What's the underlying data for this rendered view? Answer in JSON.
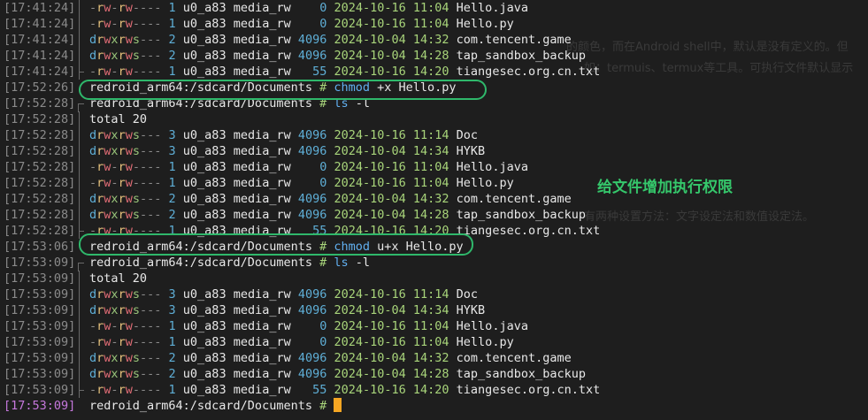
{
  "background_fragments": [
    "的颜色，而在Android shell中，默认是没有定义的。但",
    "如：termuis、termux等工具。可执行文件默认显示",
    "有两种设置方法：文字设定法和数值设定法。"
  ],
  "annotation": "给文件增加执行权限",
  "lines": [
    {
      "ts": "[17:41:24]",
      "gutter": "line",
      "type": "file",
      "perm": "-rw-rw----",
      "links": "1",
      "owner": "u0_a83",
      "group": "media_rw",
      "size": "0",
      "date": "2024-10-16",
      "time": "11:04",
      "name": "Hello.java"
    },
    {
      "ts": "[17:41:24]",
      "gutter": "line",
      "type": "file",
      "perm": "-rw-rw----",
      "links": "1",
      "owner": "u0_a83",
      "group": "media_rw",
      "size": "0",
      "date": "2024-10-16",
      "time": "11:04",
      "name": "Hello.py"
    },
    {
      "ts": "[17:41:24]",
      "gutter": "line",
      "type": "file",
      "perm": "drwxrws---",
      "links": "2",
      "owner": "u0_a83",
      "group": "media_rw",
      "size": "4096",
      "date": "2024-10-04",
      "time": "14:32",
      "name": "com.tencent.game"
    },
    {
      "ts": "[17:41:24]",
      "gutter": "line",
      "type": "file",
      "perm": "drwxrws---",
      "links": "2",
      "owner": "u0_a83",
      "group": "media_rw",
      "size": "4096",
      "date": "2024-10-04",
      "time": "14:28",
      "name": "tap_sandbox_backup"
    },
    {
      "ts": "[17:41:24]",
      "gutter": "end",
      "type": "file",
      "perm": "-rw-rw----",
      "links": "1",
      "owner": "u0_a83",
      "group": "media_rw",
      "size": "55",
      "date": "2024-10-16",
      "time": "14:20",
      "name": "tiangesec.org.cn.txt"
    },
    {
      "ts": "[17:52:26]",
      "gutter": "none",
      "type": "prompt",
      "prompt": "redroid_arm64:/sdcard/Documents",
      "hash": "#",
      "cmd": "chmod",
      "args": "+x Hello.py",
      "circled": true
    },
    {
      "ts": "[17:52:28]",
      "gutter": "start",
      "type": "prompt",
      "prompt": "redroid_arm64:/sdcard/Documents",
      "hash": "#",
      "cmd": "ls",
      "args": "-l"
    },
    {
      "ts": "[17:52:28]",
      "gutter": "line",
      "type": "text",
      "text": "total 20"
    },
    {
      "ts": "[17:52:28]",
      "gutter": "line",
      "type": "file",
      "perm": "drwxrws---",
      "links": "3",
      "owner": "u0_a83",
      "group": "media_rw",
      "size": "4096",
      "date": "2024-10-16",
      "time": "11:14",
      "name": "Doc"
    },
    {
      "ts": "[17:52:28]",
      "gutter": "line",
      "type": "file",
      "perm": "drwxrws---",
      "links": "3",
      "owner": "u0_a83",
      "group": "media_rw",
      "size": "4096",
      "date": "2024-10-04",
      "time": "14:34",
      "name": "HYKB"
    },
    {
      "ts": "[17:52:28]",
      "gutter": "line",
      "type": "file",
      "perm": "-rw-rw----",
      "links": "1",
      "owner": "u0_a83",
      "group": "media_rw",
      "size": "0",
      "date": "2024-10-16",
      "time": "11:04",
      "name": "Hello.java"
    },
    {
      "ts": "[17:52:28]",
      "gutter": "line",
      "type": "file",
      "perm": "-rw-rw----",
      "links": "1",
      "owner": "u0_a83",
      "group": "media_rw",
      "size": "0",
      "date": "2024-10-16",
      "time": "11:04",
      "name": "Hello.py"
    },
    {
      "ts": "[17:52:28]",
      "gutter": "line",
      "type": "file",
      "perm": "drwxrws---",
      "links": "2",
      "owner": "u0_a83",
      "group": "media_rw",
      "size": "4096",
      "date": "2024-10-04",
      "time": "14:32",
      "name": "com.tencent.game"
    },
    {
      "ts": "[17:52:28]",
      "gutter": "line",
      "type": "file",
      "perm": "drwxrws---",
      "links": "2",
      "owner": "u0_a83",
      "group": "media_rw",
      "size": "4096",
      "date": "2024-10-04",
      "time": "14:28",
      "name": "tap_sandbox_backup"
    },
    {
      "ts": "[17:52:28]",
      "gutter": "end",
      "type": "file",
      "perm": "-rw-rw----",
      "links": "1",
      "owner": "u0_a83",
      "group": "media_rw",
      "size": "55",
      "date": "2024-10-16",
      "time": "14:20",
      "name": "tiangesec.org.cn.txt"
    },
    {
      "ts": "[17:53:06]",
      "gutter": "none",
      "type": "prompt",
      "prompt": "redroid_arm64:/sdcard/Documents",
      "hash": "#",
      "cmd": "chmod",
      "args": "u+x Hello.py",
      "circled": true
    },
    {
      "ts": "[17:53:09]",
      "gutter": "start",
      "type": "prompt",
      "prompt": "redroid_arm64:/sdcard/Documents",
      "hash": "#",
      "cmd": "ls",
      "args": "-l"
    },
    {
      "ts": "[17:53:09]",
      "gutter": "line",
      "type": "text",
      "text": "total 20"
    },
    {
      "ts": "[17:53:09]",
      "gutter": "line",
      "type": "file",
      "perm": "drwxrws---",
      "links": "3",
      "owner": "u0_a83",
      "group": "media_rw",
      "size": "4096",
      "date": "2024-10-16",
      "time": "11:14",
      "name": "Doc"
    },
    {
      "ts": "[17:53:09]",
      "gutter": "line",
      "type": "file",
      "perm": "drwxrws---",
      "links": "3",
      "owner": "u0_a83",
      "group": "media_rw",
      "size": "4096",
      "date": "2024-10-04",
      "time": "14:34",
      "name": "HYKB"
    },
    {
      "ts": "[17:53:09]",
      "gutter": "line",
      "type": "file",
      "perm": "-rw-rw----",
      "links": "1",
      "owner": "u0_a83",
      "group": "media_rw",
      "size": "0",
      "date": "2024-10-16",
      "time": "11:04",
      "name": "Hello.java"
    },
    {
      "ts": "[17:53:09]",
      "gutter": "line",
      "type": "file",
      "perm": "-rw-rw----",
      "links": "1",
      "owner": "u0_a83",
      "group": "media_rw",
      "size": "0",
      "date": "2024-10-16",
      "time": "11:04",
      "name": "Hello.py"
    },
    {
      "ts": "[17:53:09]",
      "gutter": "line",
      "type": "file",
      "perm": "drwxrws---",
      "links": "2",
      "owner": "u0_a83",
      "group": "media_rw",
      "size": "4096",
      "date": "2024-10-04",
      "time": "14:32",
      "name": "com.tencent.game"
    },
    {
      "ts": "[17:53:09]",
      "gutter": "line",
      "type": "file",
      "perm": "drwxrws---",
      "links": "2",
      "owner": "u0_a83",
      "group": "media_rw",
      "size": "4096",
      "date": "2024-10-04",
      "time": "14:28",
      "name": "tap_sandbox_backup"
    },
    {
      "ts": "[17:53:09]",
      "gutter": "end",
      "type": "file",
      "perm": "-rw-rw----",
      "links": "1",
      "owner": "u0_a83",
      "group": "media_rw",
      "size": "55",
      "date": "2024-10-16",
      "time": "14:20",
      "name": "tiangesec.org.cn.txt"
    },
    {
      "ts": "[17:53:09]",
      "gutter": "none",
      "type": "prompt",
      "prompt": "redroid_arm64:/sdcard/Documents",
      "hash": "#",
      "cmd": "",
      "args": "",
      "active": true
    }
  ]
}
